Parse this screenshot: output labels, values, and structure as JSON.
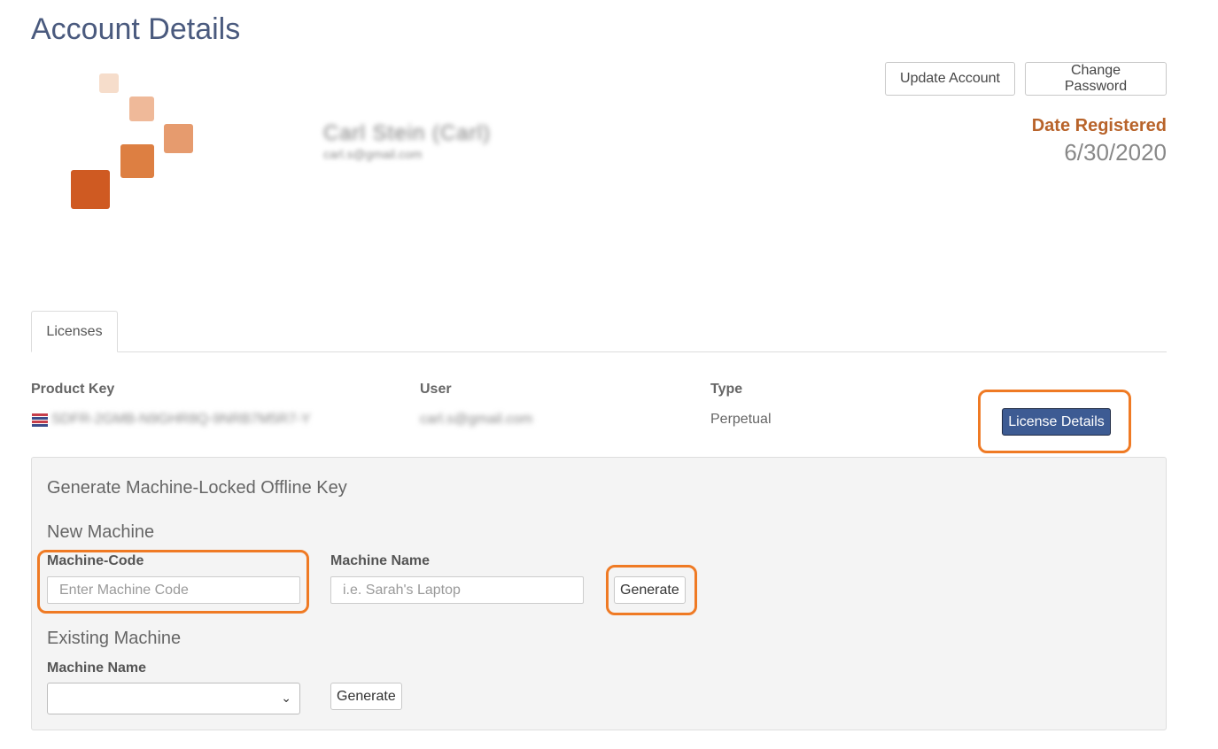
{
  "page": {
    "title": "Account Details"
  },
  "profile": {
    "name": "Carl Stein (Carl)",
    "email": "carl.s@gmail.com"
  },
  "actions": {
    "update_account": "Update Account",
    "change_password": "Change Password"
  },
  "registration": {
    "label": "Date Registered",
    "date": "6/30/2020"
  },
  "tabs": [
    {
      "label": "Licenses",
      "active": true
    }
  ],
  "licenses": {
    "headers": {
      "product_key": "Product Key",
      "user": "User",
      "type": "Type"
    },
    "rows": [
      {
        "product_key": "SDFR-2GMB-N9GHR8Q-9NRB7M5R7-Y",
        "user": "carl.s@gmail.com",
        "type": "Perpetual",
        "details_button": "License Details"
      }
    ]
  },
  "offline_key": {
    "title": "Generate Machine-Locked Offline Key",
    "new_machine": {
      "heading": "New Machine",
      "machine_code_label": "Machine-Code",
      "machine_code_placeholder": "Enter Machine Code",
      "machine_name_label": "Machine Name",
      "machine_name_placeholder": "i.e. Sarah's Laptop",
      "generate_button": "Generate"
    },
    "existing_machine": {
      "heading": "Existing Machine",
      "machine_name_label": "Machine Name",
      "selected_value": "",
      "generate_button": "Generate"
    }
  },
  "colors": {
    "title": "#4a5a7e",
    "accent": "#b8632a",
    "primary_button": "#3d5b93",
    "highlight": "#ef7a24",
    "panel_bg": "#f4f4f4"
  },
  "icons": {
    "dropdown": "chevron-down-icon",
    "flag": "flag-icon"
  }
}
